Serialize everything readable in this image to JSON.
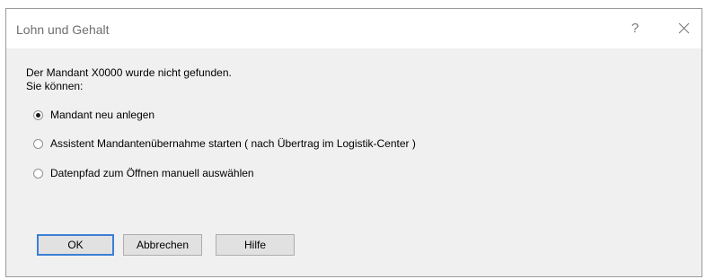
{
  "window": {
    "title": "Lohn und Gehalt",
    "help_glyph": "?",
    "close_icon": "close-icon"
  },
  "message": {
    "line1": "Der Mandant X0000 wurde nicht gefunden.",
    "line2": "Sie können:"
  },
  "options": [
    {
      "label": "Mandant neu anlegen",
      "selected": true
    },
    {
      "label": "Assistent Mandantenübernahme starten ( nach Übertrag im Logistik-Center )",
      "selected": false
    },
    {
      "label": "Datenpfad zum Öffnen manuell auswählen",
      "selected": false
    }
  ],
  "buttons": {
    "ok": "OK",
    "cancel": "Abbrechen",
    "help": "Hilfe"
  },
  "colors": {
    "focus_border": "#3c7fd6",
    "dialog_background": "#f0f0f0",
    "titlebar_background": "#ffffff"
  }
}
